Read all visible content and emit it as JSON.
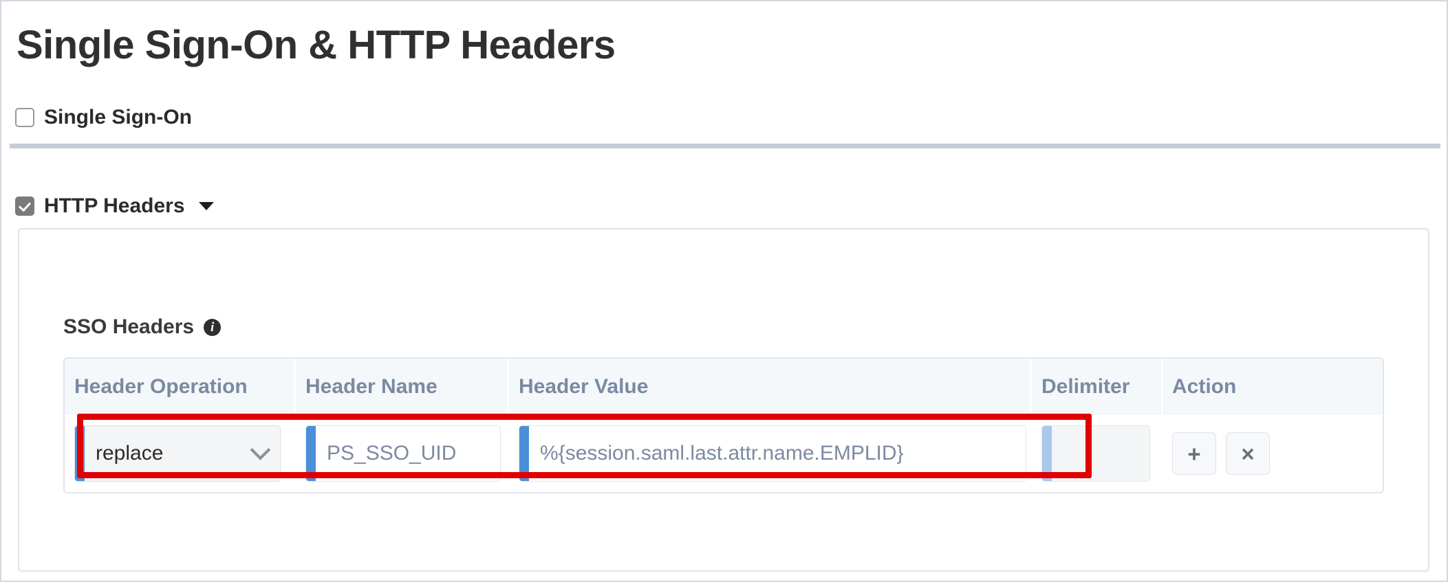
{
  "page": {
    "title": "Single Sign-On & HTTP Headers"
  },
  "sso_section": {
    "checkbox_label": "Single Sign-On",
    "checked": false
  },
  "http_headers_section": {
    "checkbox_label": "HTTP Headers",
    "checked": true,
    "caret_icon": "caret-down-icon"
  },
  "sso_headers": {
    "label": "SSO Headers",
    "info_icon": "info-icon",
    "info_glyph": "i",
    "columns": [
      "Header Operation",
      "Header Name",
      "Header Value",
      "Delimiter",
      "Action"
    ],
    "rows": [
      {
        "header_operation": "replace",
        "header_operation_options": [
          "replace"
        ],
        "header_name": "PS_SSO_UID",
        "header_value": "%{session.saml.last.attr.name.EMPLID}",
        "delimiter": "",
        "actions": {
          "add_label": "+",
          "remove_label": "×"
        }
      }
    ]
  },
  "annotation": {
    "highlight_color": "#e00000"
  },
  "colors": {
    "accent_blue": "#4a90d9",
    "accent_blue_disabled": "#a8c8ec",
    "header_text": "#7b8aa1",
    "table_header_bg": "#f4f8fb",
    "divider": "#c7ccd8"
  }
}
